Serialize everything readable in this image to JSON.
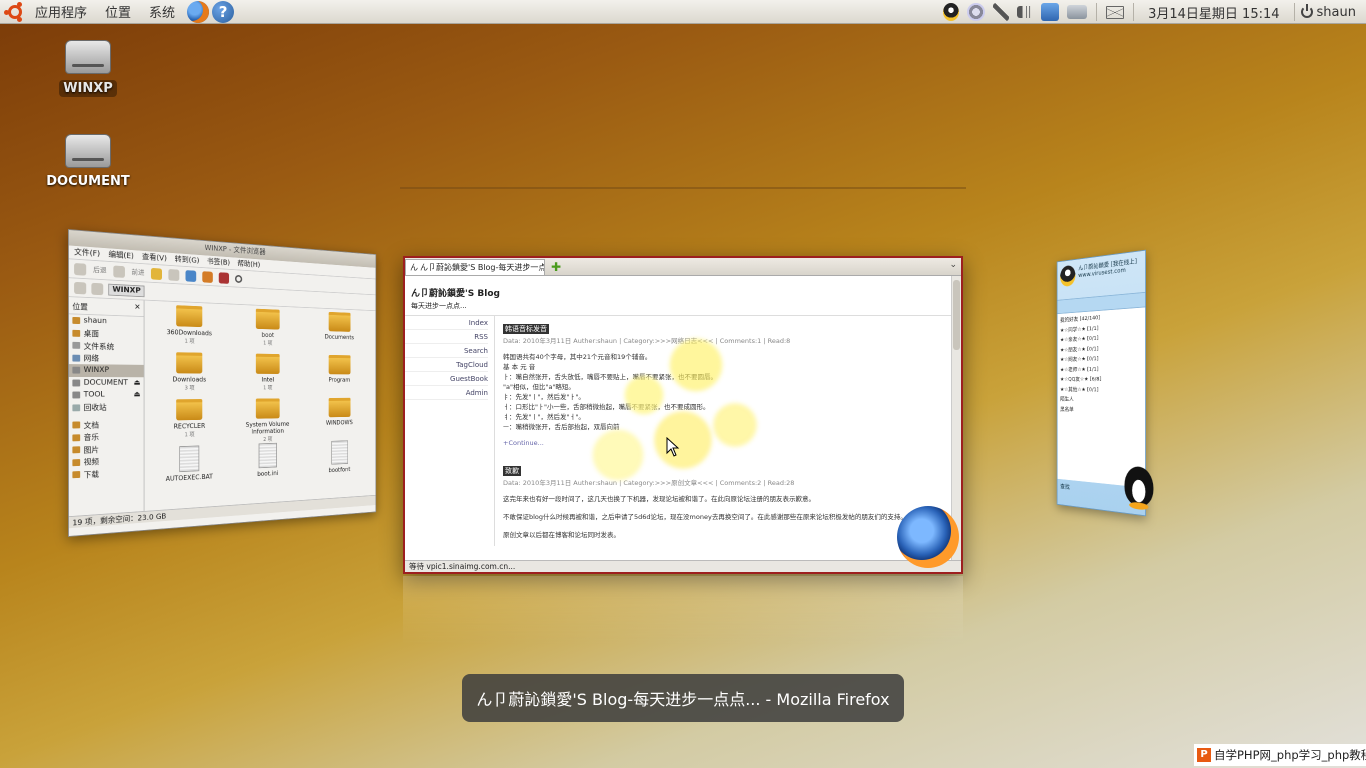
{
  "top_panel": {
    "menus": [
      "应用程序",
      "位置",
      "系统"
    ],
    "clock": "3月14日星期日 15:14",
    "user": "shaun",
    "launchers": [
      "firefox-icon",
      "help-icon"
    ],
    "tray_icons": [
      "qq-tray-icon",
      "network-monitor-icon",
      "bluetooth-icon",
      "volume-icon",
      "app-tray-icon",
      "network-icon",
      "mail-icon"
    ]
  },
  "desktop": {
    "icons": [
      {
        "label": "WINXP",
        "icon": "drive-icon",
        "selected": true
      },
      {
        "label": "DOCUMENT",
        "icon": "drive-icon",
        "selected": false
      }
    ]
  },
  "nautilus": {
    "title": "WINXP - 文件浏览器",
    "menus": [
      "文件(F)",
      "编辑(E)",
      "查看(V)",
      "转到(G)",
      "书签(B)",
      "帮助(H)"
    ],
    "toolbar": [
      "后退",
      "前进"
    ],
    "location": "WINXP",
    "sidebar_header": "位置",
    "places": [
      {
        "label": "shaun",
        "active": false
      },
      {
        "label": "桌面",
        "active": false
      },
      {
        "label": "文件系统",
        "active": false
      },
      {
        "label": "网络",
        "active": false
      },
      {
        "label": "WINXP",
        "active": true
      },
      {
        "label": "DOCUMENT",
        "active": false
      },
      {
        "label": "TOOL",
        "active": false
      },
      {
        "label": "回收站",
        "active": false
      }
    ],
    "bookmarks": [
      "文档",
      "音乐",
      "图片",
      "视频",
      "下载"
    ],
    "files": [
      {
        "name": "360Downloads",
        "count": "1 项",
        "kind": "folder"
      },
      {
        "name": "boot",
        "count": "1 项",
        "kind": "folder"
      },
      {
        "name": "Documents",
        "count": "",
        "kind": "folder"
      },
      {
        "name": "Downloads",
        "count": "3 项",
        "kind": "folder"
      },
      {
        "name": "Intel",
        "count": "1 项",
        "kind": "folder"
      },
      {
        "name": "Program",
        "count": "",
        "kind": "folder"
      },
      {
        "name": "RECYCLER",
        "count": "1 项",
        "kind": "folder"
      },
      {
        "name": "System Volume Information",
        "count": "2 项",
        "kind": "folder"
      },
      {
        "name": "WINDOWS",
        "count": "",
        "kind": "folder"
      },
      {
        "name": "AUTOEXEC.BAT",
        "count": "",
        "kind": "file"
      },
      {
        "name": "boot.ini",
        "count": "",
        "kind": "file"
      },
      {
        "name": "bootfont",
        "count": "",
        "kind": "file"
      }
    ],
    "status": "19 项，剩余空间：23.0 GB"
  },
  "firefox": {
    "tab_title": "ん卩蔚訫鎖愛'S Blog-每天进步一点点...",
    "blog_title": "ん卩蔚訫鎖愛'S Blog",
    "blog_subtitle": "每天进步一点点...",
    "nav": [
      "Index",
      "RSS",
      "Search",
      "TagCloud",
      "GuestBook",
      "Admin"
    ],
    "posts": [
      {
        "title": "韩语音标发音",
        "meta": "Data: 2010年3月11日 Auther:shaun | Category:>>>网络日志<<< | Comments:1 | Read:8",
        "lines": [
          "韩国语共有40个字母，其中21个元音和19个辅音。",
          "基 本 元 音",
          "ㅏ：嘴自然张开，舌头放低，嘴唇不要贴上，嘴唇不要紧张，也不要圆唇。",
          "\"a\"相似，但比\"a\"略短。",
          "ㅑ：先发\"ㅣ\"，然后发\"ㅏ\"。",
          "ㅓ：口形比\"ㅏ\"小一些，舌部稍微抬起，嘴唇不要紧张，也不要成圆形。",
          "ㅕ：先发\"ㅣ\"，然后发\"ㅓ\"。",
          "ㅡ：嘴稍微张开，舌后部抬起，双唇向前"
        ],
        "more": "+Continue..."
      },
      {
        "title": "致歉",
        "meta": "Data: 2010年3月11日 Auther:shaun | Category:>>>原创文章<<< | Comments:2 | Read:28",
        "lines": [
          "这完年来也有好一段时间了，这几天也换了下机器，发现论坛被和谐了。在此向原论坛注册的朋友表示歉意。",
          "不敢保证blog什么时候再被和谐，之后申请了5d6d论坛，现在没money去再换空间了。在此感谢那些在原来论坛积极发帖的朋友们的支持。",
          "原创文章以后都在博客和论坛同时发表。"
        ],
        "more": ""
      }
    ],
    "status": "等待 vpic1.sinaimg.com.cn..."
  },
  "qq": {
    "nickname": "ん卩蔚訫鎖愛 [我在线上]",
    "signature": "www.virusest.com",
    "groups": [
      "我的好友 [42/140]",
      "★☆同学☆★ [1/1]",
      "★☆亲友☆★ [0/1]",
      "★☆朋友☆★ [0/1]",
      "★☆网友☆★ [0/1]",
      "★☆老师☆★ [1/1]",
      "★☆QQ友☆★ [6/8]",
      "★☆其他☆★ [0/1]",
      "陌生人",
      "黑名单"
    ],
    "footer": "查找"
  },
  "switcher_label": "ん卩蔚訫鎖愛'S Blog-每天进步一点点... - Mozilla Firefox",
  "watermark": "自学PHP网_php学习_php教程"
}
